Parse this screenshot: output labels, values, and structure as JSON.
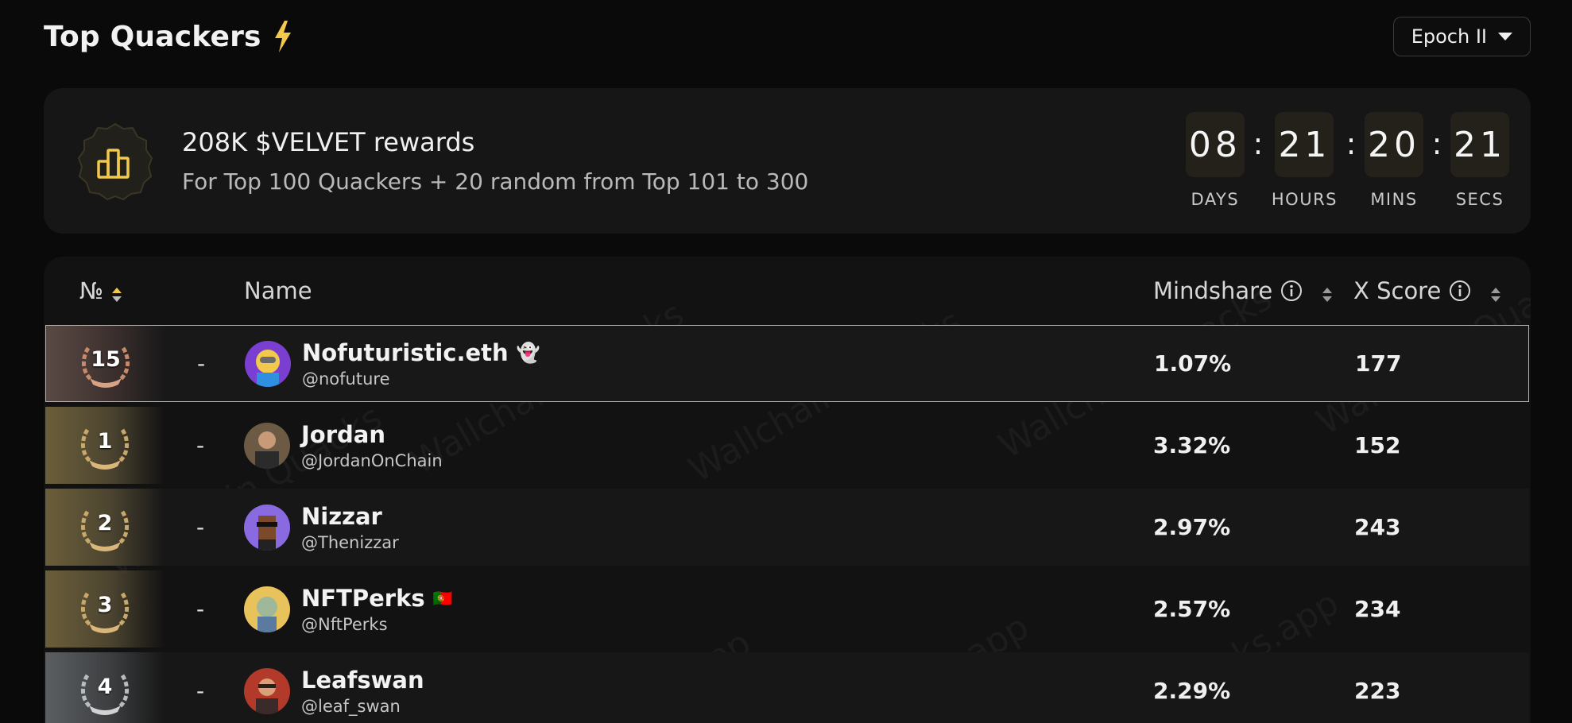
{
  "header": {
    "title": "Top Quackers",
    "epoch_label": "Epoch II"
  },
  "rewards": {
    "title": "208K $VELVET rewards",
    "subtitle": "For Top 100 Quackers + 20 random from Top 101 to 300",
    "countdown": [
      {
        "value": "08",
        "label": "DAYS"
      },
      {
        "value": "21",
        "label": "HOURS"
      },
      {
        "value": "20",
        "label": "MINS"
      },
      {
        "value": "21",
        "label": "SECS"
      }
    ],
    "separator": ":"
  },
  "table": {
    "columns": {
      "rank": "№",
      "name": "Name",
      "mindshare": "Mindshare",
      "xscore": "X Score"
    },
    "watermark": [
      "Wallchain Quacks",
      "quacks.app"
    ],
    "rows": [
      {
        "rank": "15",
        "change": "-",
        "name": "Nofuturistic.eth",
        "name_emoji": "👻",
        "handle": "@nofuture",
        "mindshare": "1.07%",
        "xscore": "177",
        "medal": "bronze",
        "highlight": true,
        "avatar_color": "#7a3fd0"
      },
      {
        "rank": "1",
        "change": "-",
        "name": "Jordan",
        "name_emoji": "",
        "handle": "@JordanOnChain",
        "mindshare": "3.32%",
        "xscore": "152",
        "medal": "gold",
        "highlight": false,
        "avatar_color": "#6d5a44"
      },
      {
        "rank": "2",
        "change": "-",
        "name": "Nizzar",
        "name_emoji": "",
        "handle": "@Thenizzar",
        "mindshare": "2.97%",
        "xscore": "243",
        "medal": "gold",
        "highlight": false,
        "avatar_color": "#8a6ae0"
      },
      {
        "rank": "3",
        "change": "-",
        "name": "NFTPerks",
        "name_emoji": "🇵🇹",
        "handle": "@NftPerks",
        "mindshare": "2.57%",
        "xscore": "234",
        "medal": "gold",
        "highlight": false,
        "avatar_color": "#e8c25a"
      },
      {
        "rank": "4",
        "change": "-",
        "name": "Leafswan",
        "name_emoji": "",
        "handle": "@leaf_swan",
        "mindshare": "2.29%",
        "xscore": "223",
        "medal": "silver",
        "highlight": false,
        "avatar_color": "#b33a2a"
      }
    ]
  },
  "colors": {
    "accent": "#f2c94c",
    "highlight_border": "#c9b56a",
    "background": "#0a0a0a",
    "card": "#161616"
  }
}
